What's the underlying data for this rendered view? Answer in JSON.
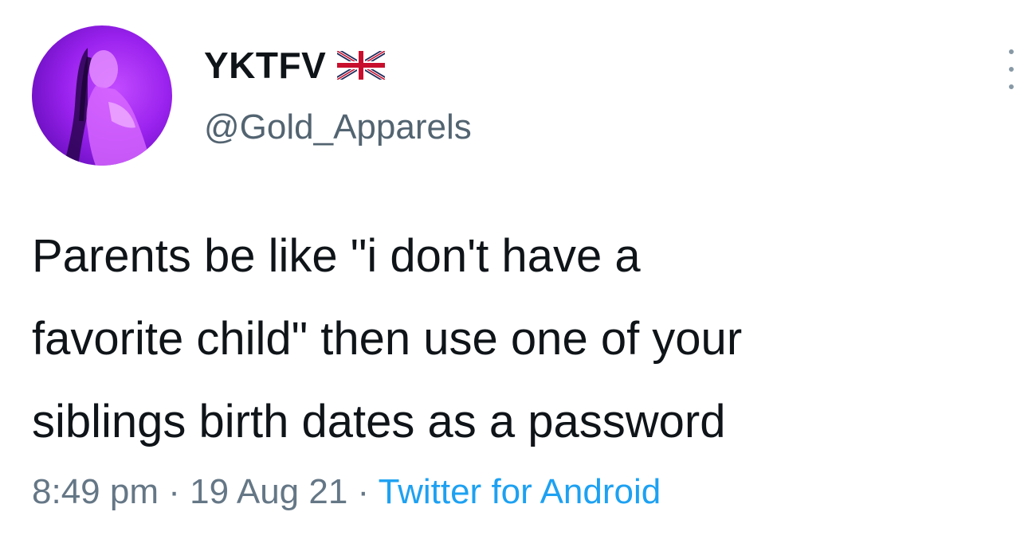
{
  "author": {
    "display_name": "YKTFV",
    "flag_icon": "uk-flag-icon",
    "handle": "@Gold_Apparels"
  },
  "tweet": {
    "text_lines": [
      "Parents be like \"i don't have a",
      "favorite child\" then use one of your",
      "siblings birth dates as a password"
    ]
  },
  "meta": {
    "time": "8:49 pm",
    "separator": "·",
    "date": "19 Aug 21",
    "source": "Twitter for Android"
  },
  "colors": {
    "text": "#0f1419",
    "secondary": "#657786",
    "link": "#1da1f2",
    "avatar_bg": "#9a22ee"
  },
  "icons": {
    "menu": "more-vertical-icon"
  }
}
